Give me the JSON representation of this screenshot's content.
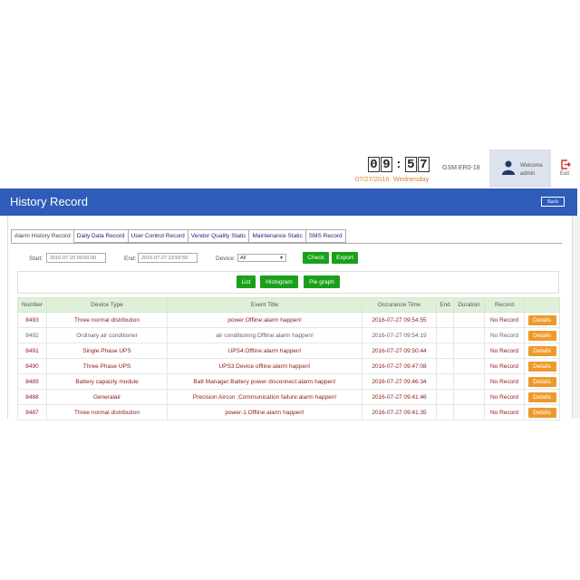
{
  "header": {
    "clock_digits": [
      "0",
      "9",
      "5",
      "7"
    ],
    "date": "07/27/2016",
    "weekday": "Wednesday",
    "device_id": "GSM ER0-18",
    "welcome": "Welcome",
    "user": "admin",
    "exit": "Exit"
  },
  "title": {
    "text": "History Record",
    "back": "Back"
  },
  "tabs": [
    {
      "label": "Alarm History Record"
    },
    {
      "label": "Daily Data Record"
    },
    {
      "label": "User Control Record"
    },
    {
      "label": "Vendor Quality Static"
    },
    {
      "label": "Maintenance Static"
    },
    {
      "label": "SMS Record"
    }
  ],
  "filters": {
    "start_label": "Start:",
    "start_value": "2016-07-25 00:00:00",
    "end_label": "End:",
    "end_value": "2016-07-27 23:59:59",
    "device_label": "Device:",
    "device_value": "All",
    "check": "Check",
    "export": "Export"
  },
  "views": {
    "list": "List",
    "histogram": "Histogram",
    "pie": "Pie graph"
  },
  "table": {
    "headers": [
      "Number",
      "Device Type",
      "Event Title",
      "Occurance Time",
      "End",
      "Duration",
      "Record",
      ""
    ],
    "rows": [
      {
        "number": "8493",
        "device": "Three normal distribution",
        "event": "power:Offline:alarm happen!",
        "time": "2016-07-27 09:54:55",
        "end": "",
        "duration": "",
        "record": "No Record",
        "action": "Details"
      },
      {
        "number": "8492",
        "device": "Ordinary air conditioner",
        "event": "air conditioning:Offline:alarm happen!",
        "time": "2016-07-27 09:54:19",
        "end": "",
        "duration": "",
        "record": "No Record",
        "action": "Details"
      },
      {
        "number": "8491",
        "device": "Single Phase UPS",
        "event": "UPS4:Offline:alarm happen!",
        "time": "2016-07-27 09:50:44",
        "end": "",
        "duration": "",
        "record": "No Record",
        "action": "Details"
      },
      {
        "number": "8490",
        "device": "Three Phase UPS",
        "event": "UPS3:Device offline:alarm happen!",
        "time": "2016-07-27 09:47:08",
        "end": "",
        "duration": "",
        "record": "No Record",
        "action": "Details"
      },
      {
        "number": "8489",
        "device": "Battery capacity module",
        "event": "Batt Manager:Battery power disconnect:alarm happen!",
        "time": "2016-07-27 09:46:34",
        "end": "",
        "duration": "",
        "record": "No Record",
        "action": "Details"
      },
      {
        "number": "8488",
        "device": "Generalair",
        "event": "Precision Aircon :Communication failure:alarm happen!",
        "time": "2016-07-27 09:41:46",
        "end": "",
        "duration": "",
        "record": "No Record",
        "action": "Details"
      },
      {
        "number": "8487",
        "device": "Three normal distribution",
        "event": "power-1:Offline:alarm happen!",
        "time": "2016-07-27 09:41:35",
        "end": "",
        "duration": "",
        "record": "No Record",
        "action": "Details"
      }
    ]
  },
  "colors": {
    "title_bar": "#2f5cb8",
    "green_button": "#1aa01a",
    "orange_button": "#ee9a2a",
    "date_text": "#d9822b"
  }
}
